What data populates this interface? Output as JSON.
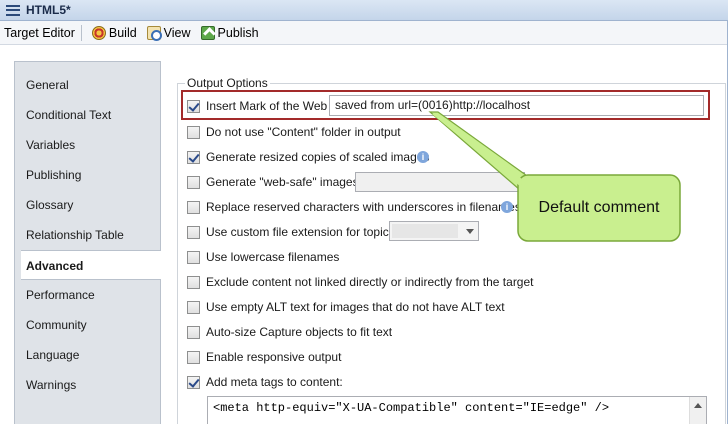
{
  "window": {
    "title": "HTML5*"
  },
  "toolbar": {
    "target_editor": "Target Editor",
    "build": "Build",
    "view": "View",
    "publish": "Publish"
  },
  "sidebar": {
    "items": [
      {
        "label": "General"
      },
      {
        "label": "Conditional Text"
      },
      {
        "label": "Variables"
      },
      {
        "label": "Publishing"
      },
      {
        "label": "Glossary"
      },
      {
        "label": "Relationship Table"
      },
      {
        "label": "Advanced",
        "active": true
      },
      {
        "label": "Performance"
      },
      {
        "label": "Community"
      },
      {
        "label": "Language"
      },
      {
        "label": "Warnings"
      }
    ]
  },
  "output_options": {
    "legend": "Output Options",
    "mark_of_web": {
      "label": "Insert Mark of the Web",
      "checked": true,
      "value": "saved from url=(0016)http://localhost"
    },
    "no_content_folder": {
      "label": "Do not use \"Content\" folder in output",
      "checked": false
    },
    "resized_copies": {
      "label": "Generate resized copies of scaled images",
      "checked": true
    },
    "web_safe": {
      "label": "Generate \"web-safe\" images",
      "checked": false
    },
    "replace_reserved": {
      "label": "Replace reserved characters with underscores in filenames",
      "checked": false
    },
    "custom_extension": {
      "label": "Use custom file extension for topics",
      "checked": false
    },
    "lowercase": {
      "label": "Use lowercase filenames",
      "checked": false
    },
    "exclude_unlinked": {
      "label": "Exclude content not linked directly or indirectly from the target",
      "checked": false
    },
    "empty_alt": {
      "label": "Use empty ALT text for images that do not have ALT text",
      "checked": false
    },
    "auto_size": {
      "label": "Auto-size Capture objects to fit text",
      "checked": false
    },
    "responsive": {
      "label": "Enable responsive output",
      "checked": false
    },
    "meta_tags": {
      "label": "Add meta tags to content:",
      "checked": true,
      "value": "<meta http-equiv=\"X-UA-Compatible\" content=\"IE=edge\" />"
    }
  },
  "callout": {
    "text": "Default comment"
  },
  "colors": {
    "highlight_border": "#a32a2a",
    "callout_fill": "#c9ef8f",
    "callout_border": "#7aa83a"
  }
}
